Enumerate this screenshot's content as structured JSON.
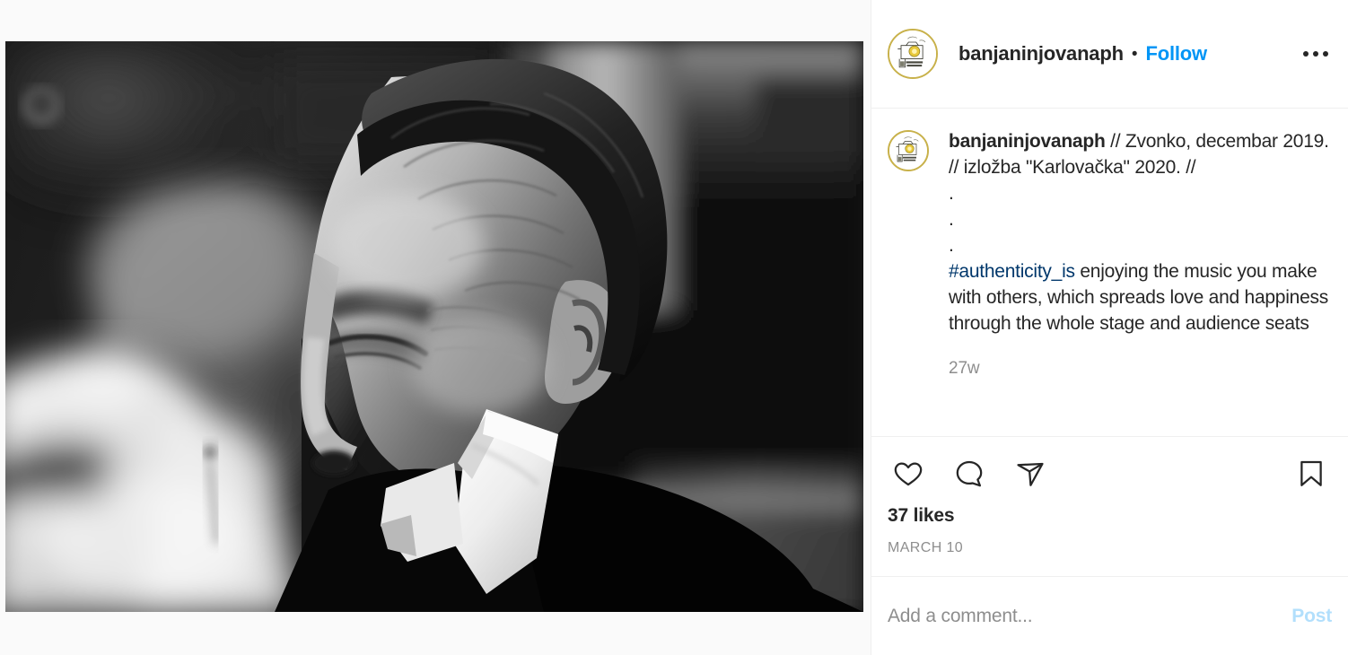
{
  "post": {
    "header": {
      "username": "banjaninjovanaph",
      "separator": "•",
      "follow_label": "Follow",
      "more_icon": "more-options-icon",
      "avatar_ring_color": "#c8b14a"
    },
    "caption": {
      "username": "banjaninjovanaph",
      "text": " // Zvonko, decembar 2019. // izložba \"Karlovačka\" 2020. //",
      "dot_lines": [
        ".",
        ".",
        "."
      ],
      "hashtag": "#authenticity_is",
      "hashtag_color": "#00376b",
      "body_after_hashtag": " enjoying the music you make with others, which spreads love and happiness through the whole stage and audience seats",
      "time_ago": "27w"
    },
    "actions": {
      "like_icon": "heart-icon",
      "comment_icon": "comment-bubble-icon",
      "share_icon": "share-paper-plane-icon",
      "save_icon": "bookmark-icon",
      "likes": "37 likes",
      "date": "MARCH 10"
    },
    "comment_box": {
      "placeholder": "Add a comment...",
      "post_label": "Post",
      "post_color": "#b2dffc"
    },
    "media": {
      "alt": "black-and-white photograph of a man in profile with eyes closed, white shirt collar, dark jacket, blurred person in white shirt at left",
      "type": "photo",
      "treatment": "black-and-white"
    },
    "theme": {
      "page_bg": "#fafafa",
      "panel_bg": "#ffffff",
      "divider": "#efefef",
      "text_primary": "#262626",
      "text_secondary": "#8e8e8e",
      "link_blue": "#0095f6"
    }
  }
}
